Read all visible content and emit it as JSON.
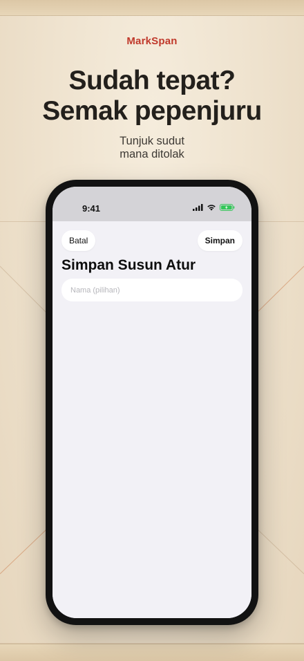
{
  "brand": "MarkSpan",
  "headline": {
    "line1": "Sudah tepat?",
    "line2": "Semak pepenjuru"
  },
  "subtitle": {
    "line1": "Tunjuk sudut",
    "line2": "mana ditolak"
  },
  "phone": {
    "status_bar": {
      "time": "9:41",
      "icons": [
        "signal-icon",
        "wifi-icon",
        "battery-charging-icon"
      ]
    },
    "sheet": {
      "cancel_label": "Batal",
      "save_label": "Simpan",
      "title": "Simpan Susun Atur",
      "name_field": {
        "value": "",
        "placeholder": "Nama (pilihan)"
      }
    }
  },
  "colors": {
    "brand": "#c0392b",
    "battery": "#34c759",
    "sheet_bg": "#f2f1f6"
  }
}
